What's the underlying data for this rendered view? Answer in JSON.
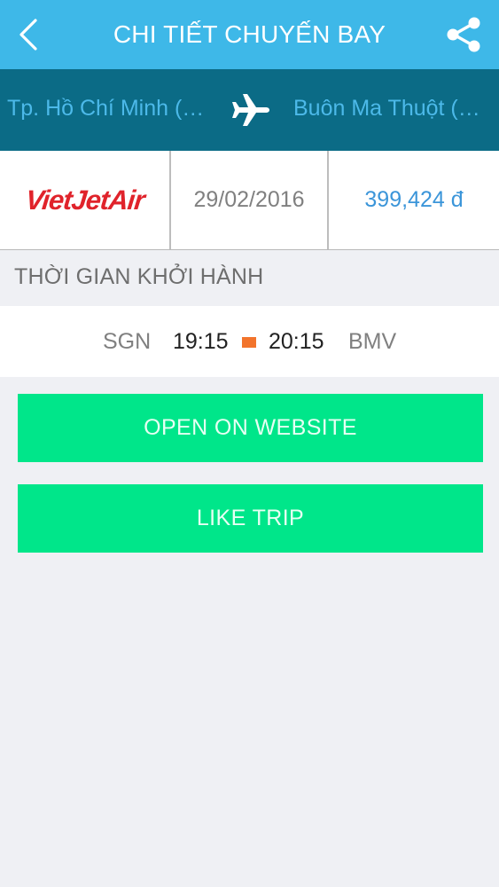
{
  "header": {
    "title": "CHI TIẾT CHUYẾN BAY",
    "back_icon": "chevron-left-icon",
    "share_icon": "share-icon"
  },
  "route": {
    "from": "Tp. Hồ Chí Minh (…",
    "to": "Buôn Ma Thuột (…",
    "plane_icon": "airplane-icon"
  },
  "flight": {
    "airline_logo_text": "VietJetAir",
    "date": "29/02/2016",
    "price": "399,424 đ"
  },
  "departure": {
    "section_label": "THỜI GIAN KHỞI HÀNH",
    "origin_code": "SGN",
    "depart_time": "19:15",
    "arrive_time": "20:15",
    "destination_code": "BMV"
  },
  "actions": {
    "open_website_label": "OPEN ON WEBSITE",
    "like_trip_label": "LIKE TRIP"
  },
  "colors": {
    "header_bg": "#3eb8e8",
    "route_bg": "#0b6b86",
    "route_text": "#4cb9e9",
    "logo_red": "#e0232b",
    "price_blue": "#3b95d9",
    "button_green": "#00e68a",
    "marker_orange": "#f2742c",
    "page_bg": "#eff0f4"
  }
}
